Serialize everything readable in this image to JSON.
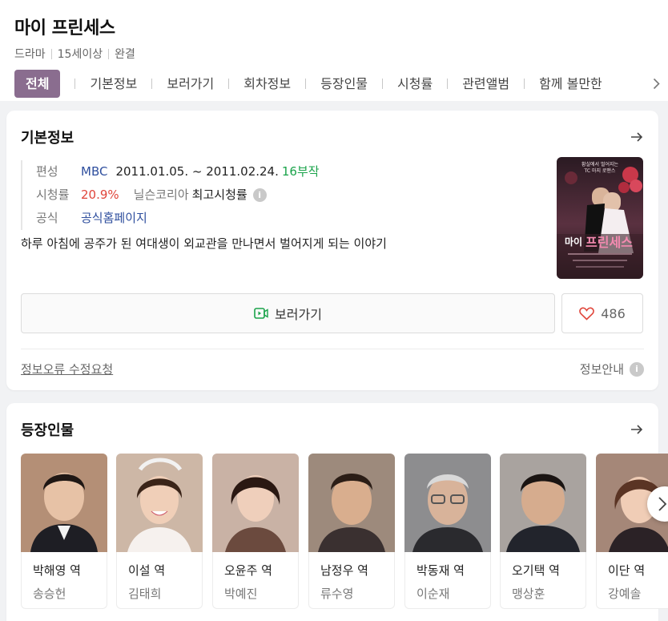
{
  "header": {
    "title": "마이 프린세스",
    "meta": [
      "드라마",
      "15세이상",
      "완결"
    ]
  },
  "tabs": [
    "전체",
    "기본정보",
    "보러가기",
    "회차정보",
    "등장인물",
    "시청률",
    "관련앨범",
    "함께 볼만한"
  ],
  "basic_info": {
    "title": "기본정보",
    "broadcast_label": "편성",
    "channel": "MBC",
    "period": "2011.01.05. ~ 2011.02.24.",
    "episodes": "16부작",
    "rating_label": "시청률",
    "rating": "20.9%",
    "rating_source": "닐슨코리아",
    "rating_type": "최고시청률",
    "official_label": "공식",
    "official_link": "공식홈페이지",
    "description": "하루 아침에 공주가 된 여대생이 외교관을 만나면서 벌어지게 되는 이야기",
    "watch_label": "보러가기",
    "like_count": "486",
    "report_label": "정보오류 수정요청",
    "guide_label": "정보안내",
    "poster_text": [
      "황실에서 벌어지는",
      "TC 마지 로맨스",
      "마이",
      "프린세스"
    ]
  },
  "cast_section": {
    "title": "등장인물",
    "cast": [
      {
        "role": "박해영 역",
        "actor": "송승헌"
      },
      {
        "role": "이설 역",
        "actor": "김태희"
      },
      {
        "role": "오윤주 역",
        "actor": "박예진"
      },
      {
        "role": "남정우 역",
        "actor": "류수영"
      },
      {
        "role": "박동재 역",
        "actor": "이순재"
      },
      {
        "role": "오기택 역",
        "actor": "맹상훈"
      },
      {
        "role": "이단 역",
        "actor": "강예솔"
      }
    ]
  },
  "icons": [
    "arrow-right-icon",
    "question-icon",
    "video-play-icon",
    "heart-icon",
    "chevron-right-icon"
  ],
  "colors": {
    "accent_tab": "#8a6d8f",
    "channel_blue": "#2f4f9e",
    "episodes_green": "#1aa34a",
    "rating_red": "#e0453a",
    "heart_red": "#e0453a",
    "play_green": "#1aa34a"
  }
}
